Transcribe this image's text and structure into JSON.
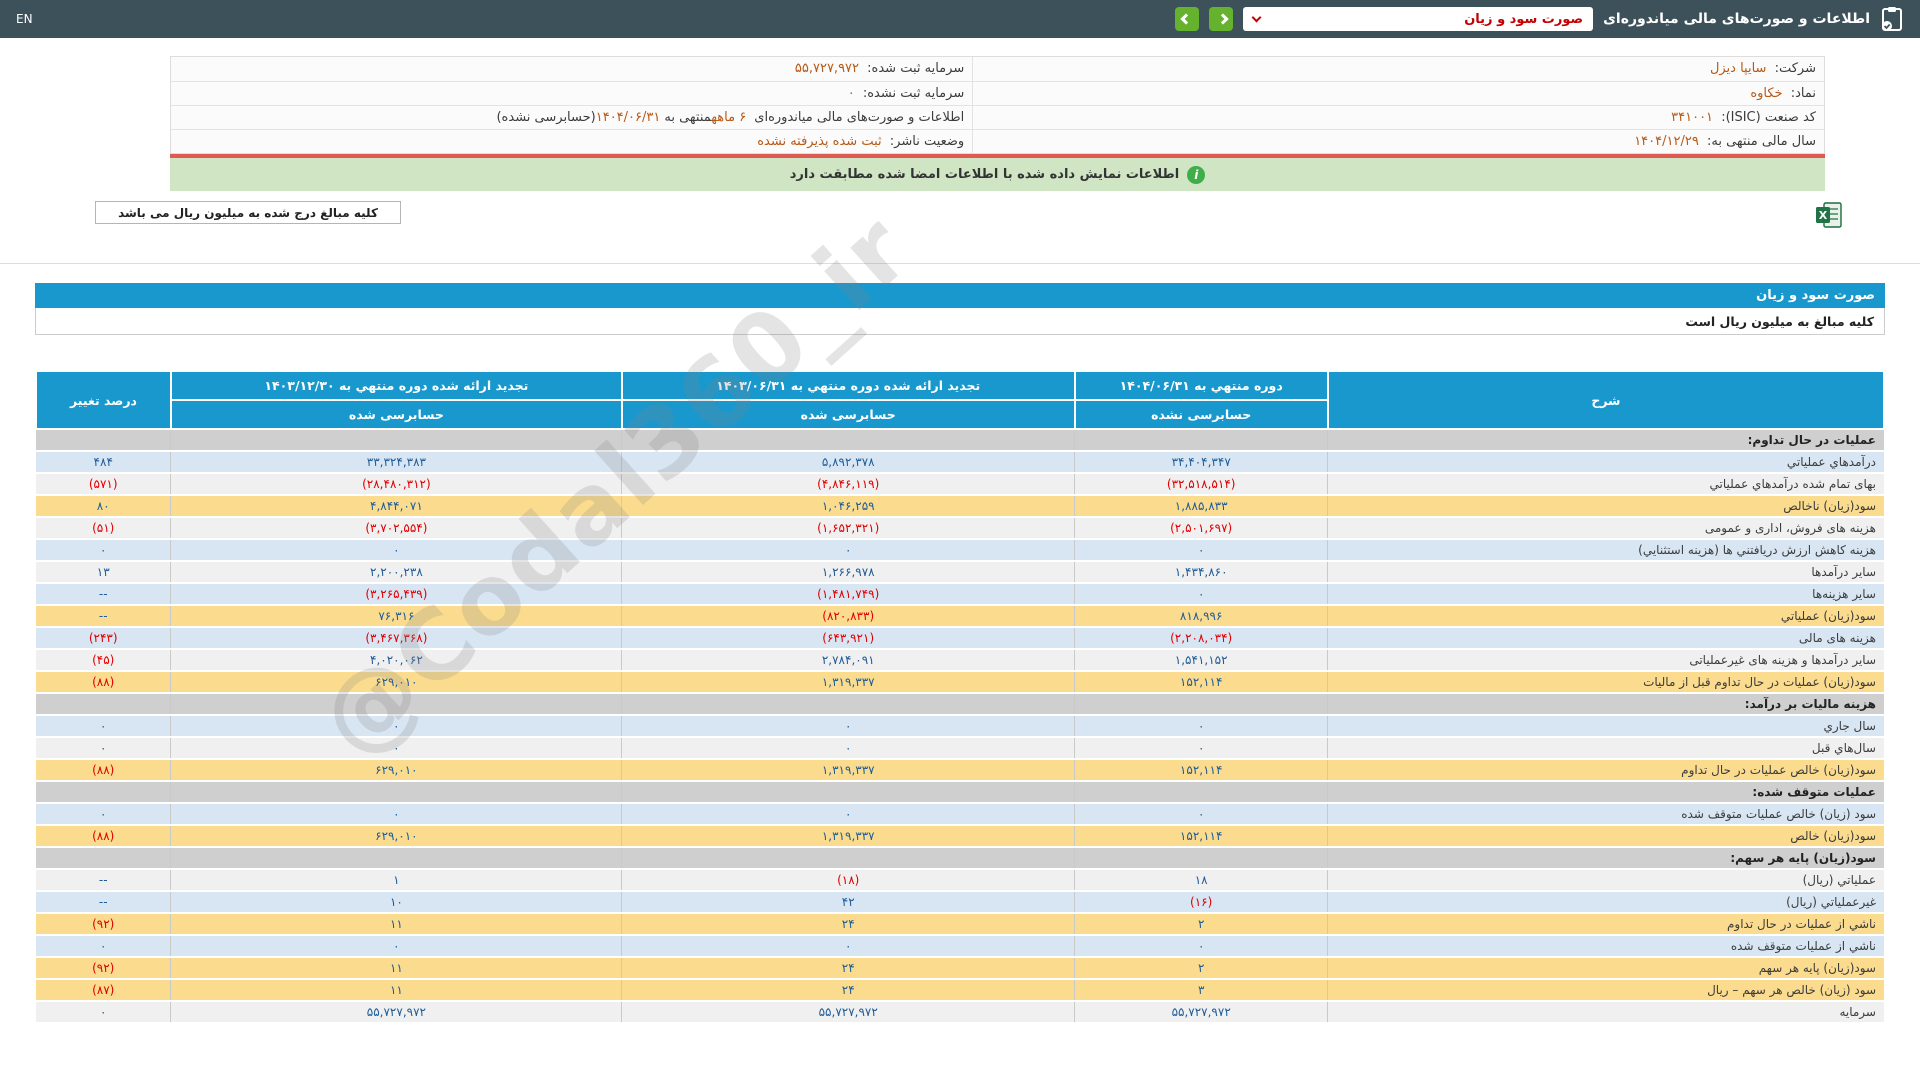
{
  "colors": {
    "topbar_bg": "#3d515a",
    "accent_blue": "#1898cd",
    "button_green": "#64b22d",
    "banner_green": "#cfe5c3",
    "alert_red_line": "#dd5b52",
    "value_orange": "#b95915",
    "row_blue": "#d8e6f4",
    "row_yellow": "#fbdc8e",
    "row_section": "#cfcfcf",
    "num_positive": "#1f5c97",
    "num_negative": "#e00000",
    "dropdown_text_red": "#c40000"
  },
  "topbar": {
    "title": "اطلاعات و صورت‌های مالی میاندوره‌ای",
    "dropdown_value": "صورت سود و زیان",
    "en_label": "EN"
  },
  "company_info": {
    "r1": {
      "label": "شرکت:",
      "value": "سایپا دیزل"
    },
    "r2": {
      "label": "نماد:",
      "value": "خکاوه"
    },
    "r3": {
      "label": "کد صنعت (ISIC):",
      "value": "۳۴۱۰۰۱"
    },
    "r4": {
      "label": "سال مالی منتهی به:",
      "value": "۱۴۰۴/۱۲/۲۹"
    },
    "l1": {
      "label": "سرمایه ثبت شده:",
      "value": "۵۵,۷۲۷,۹۷۲"
    },
    "l2": {
      "label": "سرمایه ثبت نشده:",
      "value": "۰"
    },
    "l3": {
      "pre": "اطلاعات و صورت‌های مالی میاندوره‌ای ",
      "hl1": "۶ ماهه",
      "mid": "منتهی به",
      "hl2": "۱۴۰۴/۰۶/۳۱",
      "post": "(حسابرسی نشده)"
    },
    "l4": {
      "label": "وضعیت ناشر:",
      "value": "ثبت شده پذیرفته نشده"
    }
  },
  "banner": {
    "text": "اطلاعات نمایش داده شده با اطلاعات امضا شده مطابقت دارد"
  },
  "unit_box": {
    "text": "کلیه مبالغ درج شده به میلیون ریال می باشد"
  },
  "watermark": "@Codal360_ir",
  "table": {
    "title": "صورت سود و زیان",
    "note": "کلیه مبالغ به میلیون ریال است",
    "col_desc": "شرح",
    "col1_l1": "دوره منتهي به ۱۴۰۴/۰۶/۳۱",
    "col1_l2": "حسابرسی نشده",
    "col2_l1": "تجدید ارائه شده دوره منتهي به ۱۴۰۳/۰۶/۳۱",
    "col2_l2": "حسابرسی شده",
    "col3_l1": "تجدید ارائه شده دوره منتهي به ۱۴۰۳/۱۲/۳۰",
    "col3_l2": "حسابرسی شده",
    "col_pct": "درصد تغییر",
    "rows": [
      {
        "type": "section",
        "bg": "section",
        "label": "عملیات در حال تداوم:",
        "v1": "",
        "v2": "",
        "v3": "",
        "pct": ""
      },
      {
        "type": "data",
        "bg": "blue",
        "label": "درآمدهاي عملیاتي",
        "v1": "۳۴,۴۰۴,۳۴۷",
        "v2": "۵,۸۹۲,۳۷۸",
        "v3": "۳۳,۳۲۴,۳۸۳",
        "pct": "۴۸۴"
      },
      {
        "type": "data",
        "bg": "white",
        "label": "بهای تمام شده درآمدهاي عملیاتي",
        "v1": "(۳۲,۵۱۸,۵۱۴)",
        "v2": "(۴,۸۴۶,۱۱۹)",
        "v3": "(۲۸,۴۸۰,۳۱۲)",
        "pct": "(۵۷۱)"
      },
      {
        "type": "data",
        "bg": "yellow",
        "label": "سود(زیان) ناخالص",
        "v1": "۱,۸۸۵,۸۳۳",
        "v2": "۱,۰۴۶,۲۵۹",
        "v3": "۴,۸۴۴,۰۷۱",
        "pct": "۸۰"
      },
      {
        "type": "data",
        "bg": "white",
        "label": "هزینه های فروش، اداری و عمومی",
        "v1": "(۲,۵۰۱,۶۹۷)",
        "v2": "(۱,۶۵۲,۳۲۱)",
        "v3": "(۳,۷۰۲,۵۵۴)",
        "pct": "(۵۱)"
      },
      {
        "type": "data",
        "bg": "blue",
        "label": "هزینه کاهش ارزش دریافتني ها (هزینه استثنایي)",
        "v1": "۰",
        "v2": "۰",
        "v3": "۰",
        "pct": "۰"
      },
      {
        "type": "data",
        "bg": "white",
        "label": "سایر درآمدها",
        "v1": "۱,۴۳۴,۸۶۰",
        "v2": "۱,۲۶۶,۹۷۸",
        "v3": "۲,۲۰۰,۲۳۸",
        "pct": "۱۳"
      },
      {
        "type": "data",
        "bg": "blue",
        "label": "سایر هزینه‌ها",
        "v1": "۰",
        "v2": "(۱,۴۸۱,۷۴۹)",
        "v3": "(۳,۲۶۵,۴۳۹)",
        "pct": "--"
      },
      {
        "type": "data",
        "bg": "yellow",
        "label": "سود(زیان) عملیاتي",
        "v1": "۸۱۸,۹۹۶",
        "v2": "(۸۲۰,۸۳۳)",
        "v3": "۷۶,۳۱۶",
        "pct": "--"
      },
      {
        "type": "data",
        "bg": "blue",
        "label": "هزینه های مالی",
        "v1": "(۲,۲۰۸,۰۳۴)",
        "v2": "(۶۴۳,۹۲۱)",
        "v3": "(۳,۴۶۷,۳۶۸)",
        "pct": "(۲۴۳)"
      },
      {
        "type": "data",
        "bg": "white",
        "label": "سایر درآمدها و هزینه های غیرعملیاتی",
        "v1": "۱,۵۴۱,۱۵۲",
        "v2": "۲,۷۸۴,۰۹۱",
        "v3": "۴,۰۲۰,۰۶۲",
        "pct": "(۴۵)"
      },
      {
        "type": "data",
        "bg": "yellow",
        "label": "سود(زیان) عملیات در حال تداوم قبل از مالیات",
        "v1": "۱۵۲,۱۱۴",
        "v2": "۱,۳۱۹,۳۳۷",
        "v3": "۶۲۹,۰۱۰",
        "pct": "(۸۸)"
      },
      {
        "type": "section",
        "bg": "section",
        "label": "هزینه مالیات بر درآمد:",
        "v1": "",
        "v2": "",
        "v3": "",
        "pct": ""
      },
      {
        "type": "data",
        "bg": "blue",
        "label": "سال جاري",
        "v1": "۰",
        "v2": "۰",
        "v3": "۰",
        "pct": "۰"
      },
      {
        "type": "data",
        "bg": "white",
        "label": "سال‌هاي قبل",
        "v1": "۰",
        "v2": "۰",
        "v3": "۰",
        "pct": "۰"
      },
      {
        "type": "data",
        "bg": "yellow",
        "label": "سود(زیان) خالص عملیات در حال تداوم",
        "v1": "۱۵۲,۱۱۴",
        "v2": "۱,۳۱۹,۳۳۷",
        "v3": "۶۲۹,۰۱۰",
        "pct": "(۸۸)"
      },
      {
        "type": "section",
        "bg": "section",
        "label": "عملیات متوقف شده:",
        "v1": "",
        "v2": "",
        "v3": "",
        "pct": ""
      },
      {
        "type": "data",
        "bg": "blue",
        "label": "سود (زیان) خالص عملیات متوقف شده",
        "v1": "۰",
        "v2": "۰",
        "v3": "۰",
        "pct": "۰"
      },
      {
        "type": "data",
        "bg": "yellow",
        "label": "سود(زیان) خالص",
        "v1": "۱۵۲,۱۱۴",
        "v2": "۱,۳۱۹,۳۳۷",
        "v3": "۶۲۹,۰۱۰",
        "pct": "(۸۸)"
      },
      {
        "type": "section",
        "bg": "section",
        "label": "سود(زیان) پایه هر سهم:",
        "v1": "",
        "v2": "",
        "v3": "",
        "pct": ""
      },
      {
        "type": "data",
        "bg": "white",
        "label": "عملیاتي (ریال)",
        "v1": "۱۸",
        "v2": "(۱۸)",
        "v3": "۱",
        "pct": "--"
      },
      {
        "type": "data",
        "bg": "blue",
        "label": "غیرعملیاتي (ریال)",
        "v1": "(۱۶)",
        "v2": "۴۲",
        "v3": "۱۰",
        "pct": "--"
      },
      {
        "type": "data",
        "bg": "yellow",
        "label": "ناشي از عملیات در حال تداوم",
        "v1": "۲",
        "v2": "۲۴",
        "v3": "۱۱",
        "pct": "(۹۲)"
      },
      {
        "type": "data",
        "bg": "blue",
        "label": "ناشي از عملیات متوقف شده",
        "v1": "۰",
        "v2": "۰",
        "v3": "۰",
        "pct": "۰"
      },
      {
        "type": "data",
        "bg": "yellow",
        "label": "سود(زیان) پایه هر سهم",
        "v1": "۲",
        "v2": "۲۴",
        "v3": "۱۱",
        "pct": "(۹۲)"
      },
      {
        "type": "data",
        "bg": "yellow",
        "label": "سود (زیان) خالص هر سهم – ریال",
        "v1": "۳",
        "v2": "۲۴",
        "v3": "۱۱",
        "pct": "(۸۷)"
      },
      {
        "type": "data",
        "bg": "white",
        "label": "سرمایه",
        "v1": "۵۵,۷۲۷,۹۷۲",
        "v2": "۵۵,۷۲۷,۹۷۲",
        "v3": "۵۵,۷۲۷,۹۷۲",
        "pct": "۰"
      }
    ]
  }
}
